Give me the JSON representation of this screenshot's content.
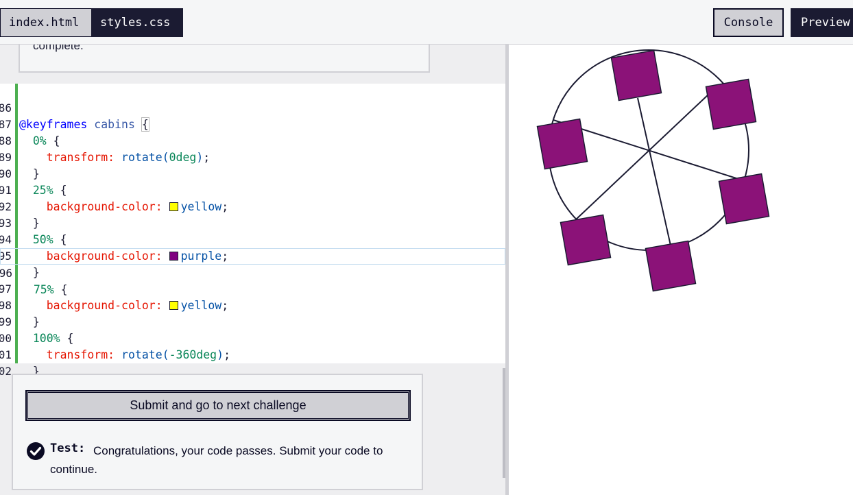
{
  "tabs": [
    {
      "label": "index.html",
      "active": false
    },
    {
      "label": "styles.css",
      "active": true
    }
  ],
  "buttons": {
    "console": "Console",
    "preview": "Preview"
  },
  "description_tail": "complete.",
  "code_lines": [
    {
      "n": "86"
    },
    {
      "n": "87"
    },
    {
      "n": "88"
    },
    {
      "n": "89"
    },
    {
      "n": "90"
    },
    {
      "n": "91"
    },
    {
      "n": "92"
    },
    {
      "n": "93"
    },
    {
      "n": "94"
    },
    {
      "n": "95"
    },
    {
      "n": "96"
    },
    {
      "n": "97"
    },
    {
      "n": "98"
    },
    {
      "n": "99"
    },
    {
      "n": "00"
    },
    {
      "n": "01"
    },
    {
      "n": "02"
    }
  ],
  "code": {
    "at": "@keyframes",
    "name": "cabins",
    "p0": "0%",
    "p25": "25%",
    "p50": "50%",
    "p75": "75%",
    "p100": "100%",
    "transform": "transform:",
    "bg": "background-color:",
    "rot0": "rotate(",
    "rot0_num": "0deg",
    "rot360_num": "-360deg",
    "yellow": "yellow",
    "purple": "purple"
  },
  "colors": {
    "yellow": "#ffff00",
    "purple": "#800080",
    "cabin": "#8b1278",
    "gutter": "#4caf50"
  },
  "test": {
    "submit_label": "Submit and go to next challenge",
    "label": "Test:",
    "message": "Congratulations, your code passes. Submit your code to continue."
  },
  "preview": {
    "cabin_count": 6,
    "icons": [
      "ferris-wheel"
    ]
  }
}
